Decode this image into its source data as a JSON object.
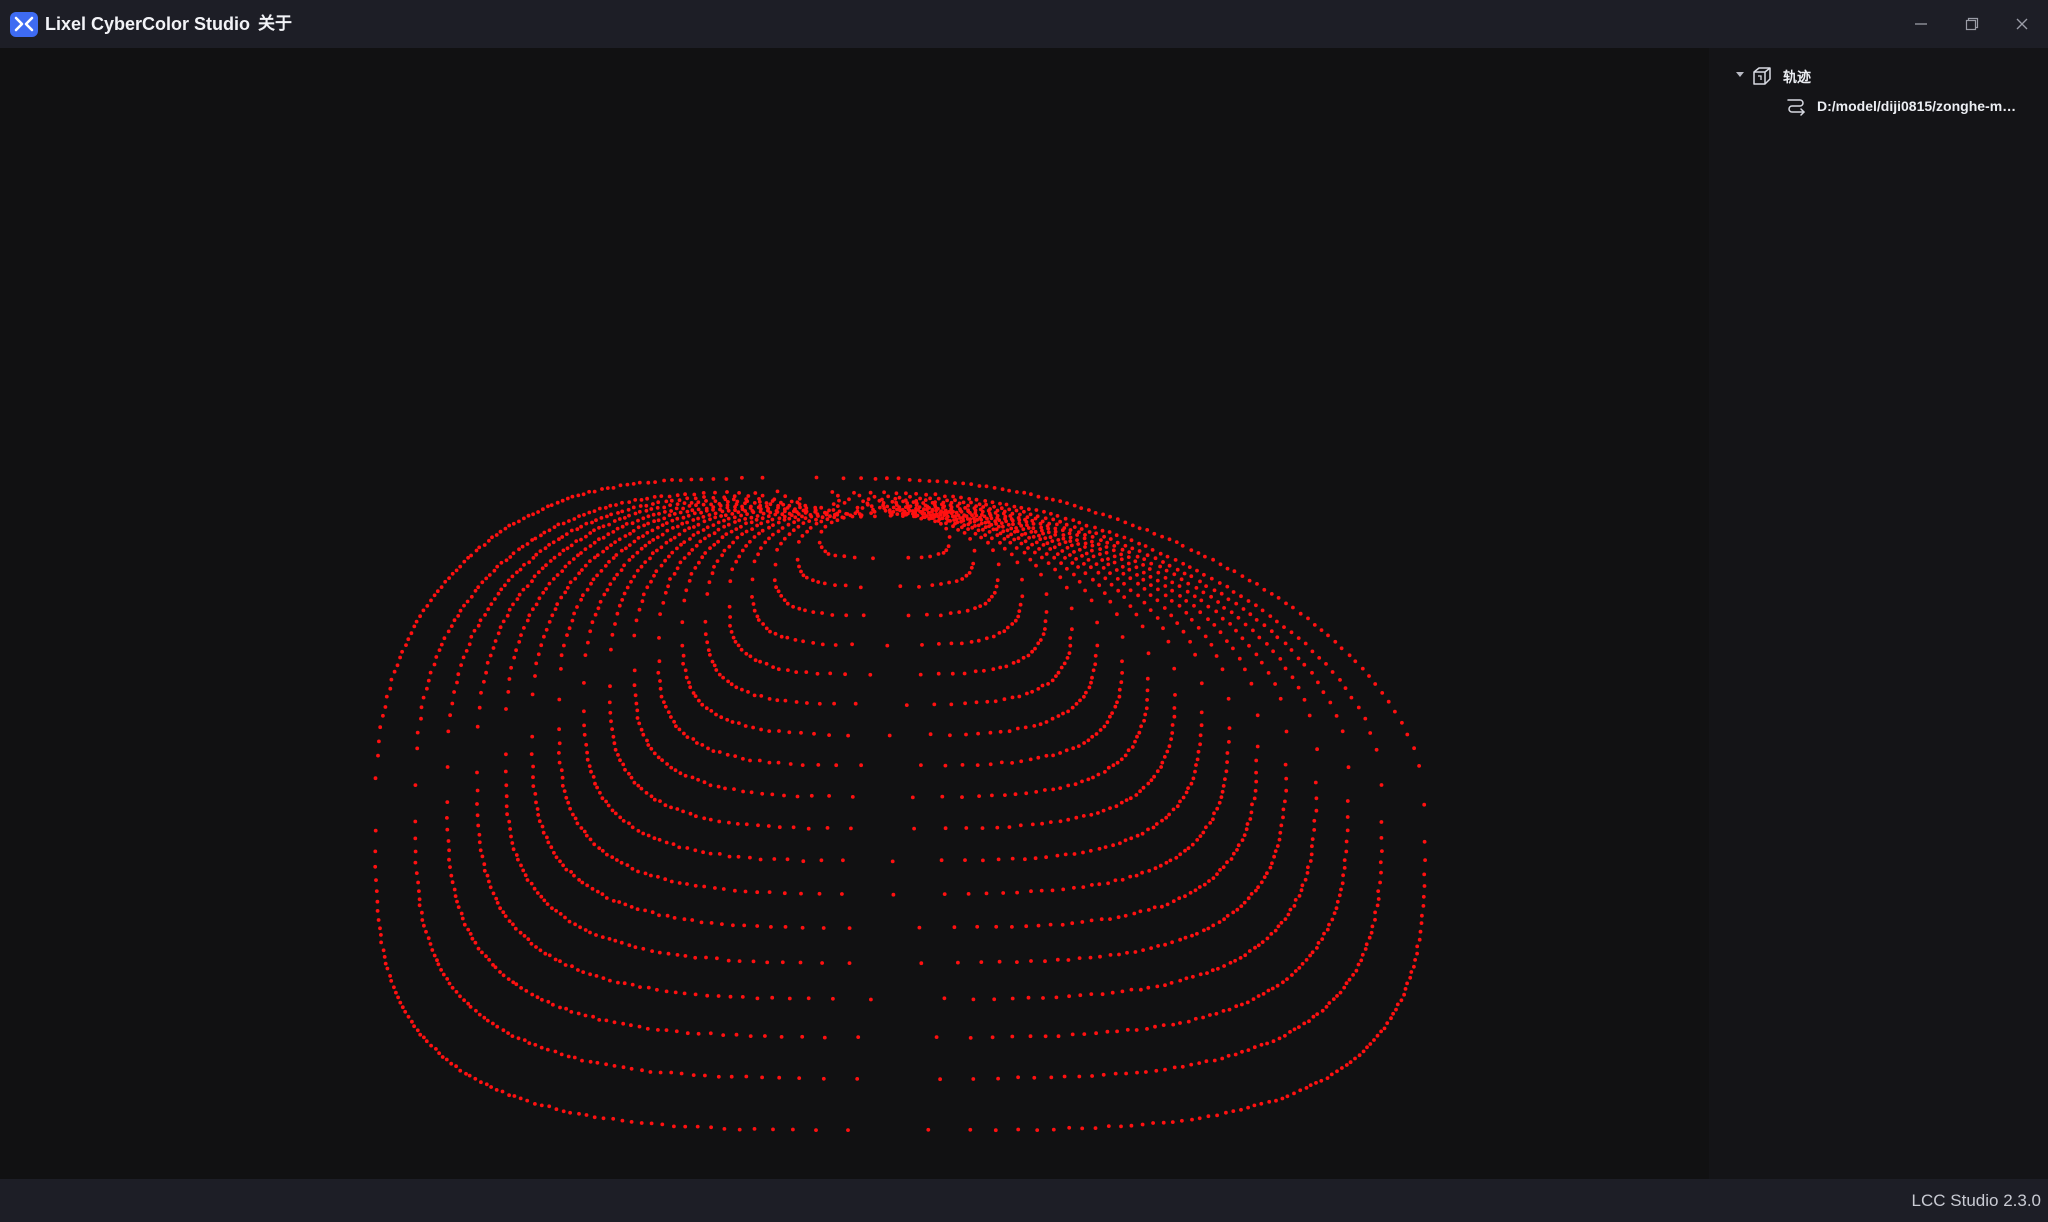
{
  "window": {
    "title": "Lixel CyberColor Studio",
    "menu": [
      "关于"
    ],
    "controls": [
      "minimize-icon",
      "maximize-icon",
      "close-icon"
    ]
  },
  "scene_tree": {
    "root": {
      "label": "轨迹",
      "expanded": true,
      "icon": "cube-icon",
      "children": [
        {
          "label": "D:/model/diji0815/zonghe-m…",
          "icon": "trajectory-icon"
        }
      ]
    }
  },
  "viewport": {
    "content": "trajectory-point-cloud",
    "point_color": "#ff1010",
    "background": "#111112"
  },
  "status_bar": {
    "version": "LCC Studio 2.3.0"
  },
  "colors": {
    "accent": "#3e6bf2",
    "titlebar": "#1d1e26",
    "panel": "#141417"
  }
}
